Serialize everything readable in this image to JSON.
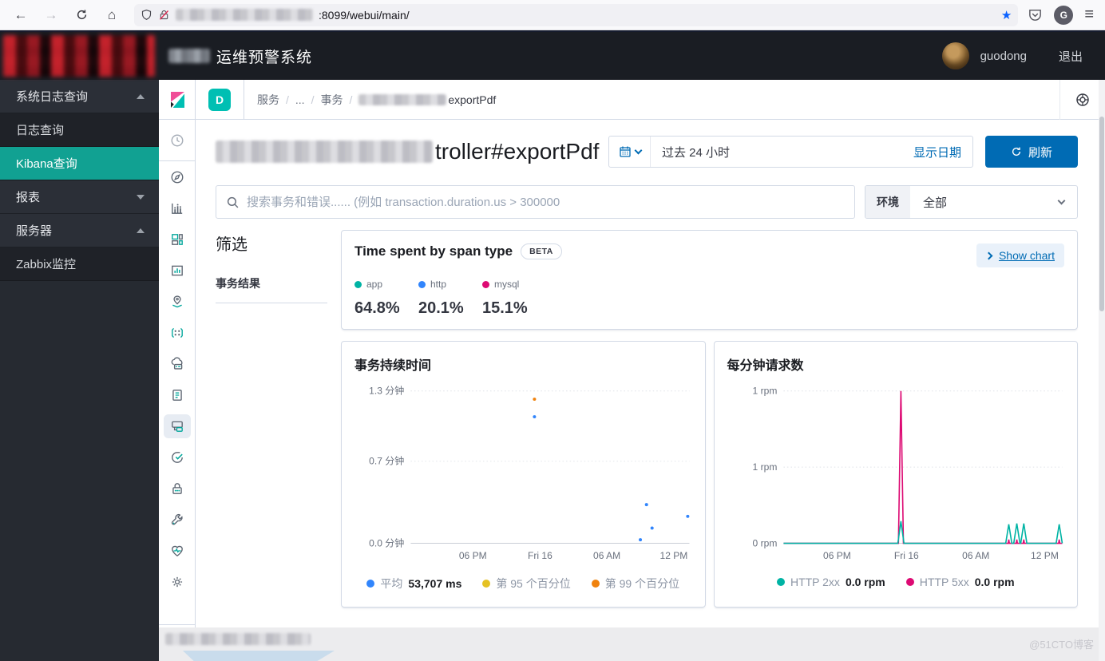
{
  "icons": {
    "back": "←",
    "forward": "→",
    "home": "⌂",
    "menu": "≡",
    "star": "★",
    "avatar_letter": "G"
  },
  "browser": {
    "url": ":8099/webui/main/"
  },
  "app_header": {
    "title": "运维预警系统",
    "username": "guodong",
    "logout": "退出"
  },
  "sidebar": {
    "items": [
      {
        "label": "系统日志查询",
        "state": "expanded"
      },
      {
        "label": "日志查询",
        "state": "child"
      },
      {
        "label": "Kibana查询",
        "state": "child-selected"
      },
      {
        "label": "报表",
        "state": "collapsed"
      },
      {
        "label": "服务器",
        "state": "expanded"
      },
      {
        "label": "Zabbix监控",
        "state": "child"
      }
    ]
  },
  "kibana_rail": {
    "icons": [
      "kibana-logo",
      "recently-viewed",
      "discover",
      "visualize",
      "dashboard",
      "canvas",
      "maps",
      "machine-learning",
      "infrastructure",
      "logs",
      "apm",
      "uptime",
      "siem",
      "dev-tools",
      "stack-monitoring",
      "management",
      "collapse-nav"
    ],
    "selected": "apm"
  },
  "breadcrumb": {
    "badge": "D",
    "items": [
      "服务",
      "...",
      "事务"
    ],
    "current": "exportPdf"
  },
  "page": {
    "title_visible": "troller#exportPdf",
    "timepicker": {
      "value": "过去 24 小时",
      "show_dates": "显示日期",
      "refresh": "刷新"
    },
    "search_placeholder": "搜索事务和错误...... (例如 transaction.duration.us > 300000",
    "env": {
      "label": "环境",
      "value": "全部"
    },
    "filters": {
      "heading": "筛选",
      "section": "事务结果"
    }
  },
  "span_panel": {
    "title": "Time spent by span type",
    "beta": "BETA",
    "show_chart": "Show chart",
    "items": [
      {
        "label": "app",
        "color": "#00b3a4",
        "value": "64.8%"
      },
      {
        "label": "http",
        "color": "#3185fc",
        "value": "20.1%"
      },
      {
        "label": "mysql",
        "color": "#dd0a73",
        "value": "15.1%"
      }
    ]
  },
  "chart_data": [
    {
      "type": "scatter",
      "title": "事务持续时间",
      "ylabel": "分钟",
      "ylim": [
        0,
        1.3
      ],
      "grid": "dotted",
      "legend_position": "bottom",
      "y_ticks": [
        {
          "value": 0,
          "label": "0.0 分钟"
        },
        {
          "value": 0.7,
          "label": "0.7 分钟"
        },
        {
          "value": 1.3,
          "label": "1.3 分钟"
        }
      ],
      "x_ticks": [
        {
          "pos": 0.223,
          "label": "06 PM"
        },
        {
          "pos": 0.464,
          "label": "Fri 16"
        },
        {
          "pos": 0.704,
          "label": "06 AM"
        },
        {
          "pos": 0.944,
          "label": "12 PM"
        }
      ],
      "series": [
        {
          "name": "平均",
          "type": "scatter",
          "color": "#3185fc",
          "points": [
            [
              0.444,
              1.08
            ],
            [
              0.824,
              0.03
            ],
            [
              0.846,
              0.33
            ],
            [
              0.866,
              0.13
            ],
            [
              0.994,
              0.23
            ]
          ]
        },
        {
          "name": "第 95 个百分位",
          "type": "scatter",
          "color": "#e5c224",
          "points": []
        },
        {
          "name": "第 99 个百分位",
          "type": "scatter",
          "color": "#f0820d",
          "points": [
            [
              0.444,
              1.23
            ]
          ]
        }
      ],
      "legend": [
        {
          "label": "平均",
          "value": "53,707 ms",
          "color": "#3185fc"
        },
        {
          "label": "第 95 个百分位",
          "value": "",
          "color": "#e5c224"
        },
        {
          "label": "第 99 个百分位",
          "value": "",
          "color": "#f0820d"
        }
      ]
    },
    {
      "type": "line",
      "title": "每分钟请求数",
      "ylabel": "rpm",
      "ylim": [
        0,
        2
      ],
      "grid": "dotted",
      "legend_position": "bottom",
      "y_ticks": [
        {
          "value": 0,
          "label": "0 rpm"
        },
        {
          "value": 1,
          "label": "1 rpm"
        },
        {
          "value": 2,
          "label": "1 rpm"
        }
      ],
      "x_ticks": [
        {
          "pos": 0.192,
          "label": "06 PM"
        },
        {
          "pos": 0.441,
          "label": "Fri 16"
        },
        {
          "pos": 0.69,
          "label": "06 AM"
        },
        {
          "pos": 0.937,
          "label": "12 PM"
        }
      ],
      "series": [
        {
          "name": "HTTP 5xx",
          "type": "line",
          "color": "#dd0a73",
          "points": [
            [
              0,
              0
            ],
            [
              0.412,
              0
            ],
            [
              0.421,
              2.0
            ],
            [
              0.43,
              0
            ],
            [
              0.806,
              0
            ],
            [
              0.808,
              0.05
            ],
            [
              0.81,
              0
            ],
            [
              0.835,
              0
            ],
            [
              0.837,
              0.05
            ],
            [
              0.839,
              0
            ],
            [
              0.86,
              0
            ],
            [
              0.862,
              0.05
            ],
            [
              0.864,
              0
            ],
            [
              0.987,
              0
            ],
            [
              0.989,
              0.05
            ],
            [
              0.991,
              0
            ],
            [
              1,
              0
            ]
          ]
        },
        {
          "name": "HTTP 2xx",
          "type": "line",
          "color": "#00b3a4",
          "points": [
            [
              0,
              0
            ],
            [
              0.41,
              0
            ],
            [
              0.421,
              0.29
            ],
            [
              0.432,
              0
            ],
            [
              0.797,
              0
            ],
            [
              0.808,
              0.25
            ],
            [
              0.819,
              0
            ],
            [
              0.826,
              0
            ],
            [
              0.837,
              0.26
            ],
            [
              0.848,
              0
            ],
            [
              0.851,
              0
            ],
            [
              0.862,
              0.26
            ],
            [
              0.873,
              0
            ],
            [
              0.978,
              0
            ],
            [
              0.989,
              0.25
            ],
            [
              1,
              0
            ]
          ]
        }
      ],
      "legend": [
        {
          "label": "HTTP 2xx",
          "value": "0.0 rpm",
          "color": "#00b3a4"
        },
        {
          "label": "HTTP 5xx",
          "value": "0.0 rpm",
          "color": "#dd0a73"
        }
      ]
    }
  ],
  "footer": {
    "watermark": "@51CTO博客"
  }
}
